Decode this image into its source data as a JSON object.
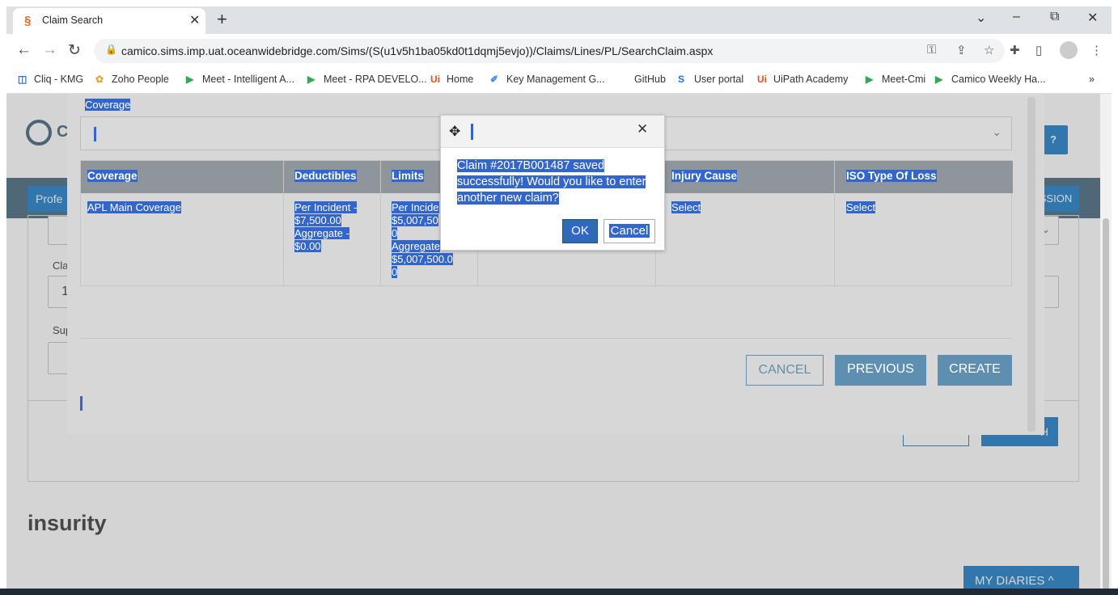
{
  "browser": {
    "tab_title": "Claim Search",
    "url": "camico.sims.imp.uat.oceanwidebridge.com/Sims/(S(u1v5h1ba05kd0t1dqmj5evjo))/Claims/Lines/PL/SearchClaim.aspx",
    "new_tab": "+",
    "close_tab": "✕",
    "minimize": "–",
    "restore": "⧉",
    "close_window": "✕",
    "chevron": "⌄"
  },
  "bookmarks": [
    {
      "label": "Cliq - KMG",
      "icon": "cliq-icon",
      "glyph": "◫",
      "color": "#1a73e8"
    },
    {
      "label": "Zoho People",
      "icon": "zoho-people-icon",
      "glyph": "✿",
      "color": "#e8a33b"
    },
    {
      "label": "Meet - Intelligent A...",
      "icon": "google-meet-icon",
      "glyph": "▶",
      "color": "#34a853"
    },
    {
      "label": "Meet - RPA DEVELO...",
      "icon": "google-meet-icon",
      "glyph": "▶",
      "color": "#34a853"
    },
    {
      "label": "Home",
      "icon": "uipath-icon",
      "glyph": "Ui",
      "color": "#fa4616"
    },
    {
      "label": "Key Management G...",
      "icon": "key-management-icon",
      "glyph": "✐",
      "color": "#4285f4"
    },
    {
      "label": "GitHub",
      "icon": "github-icon",
      "glyph": "",
      "color": "#333"
    },
    {
      "label": "User portal",
      "icon": "user-portal-icon",
      "glyph": "S",
      "color": "#1a73e8"
    },
    {
      "label": "UiPath Academy",
      "icon": "uipath-icon",
      "glyph": "Ui",
      "color": "#fa4616"
    },
    {
      "label": "Meet-Cmi",
      "icon": "google-meet-icon",
      "glyph": "▶",
      "color": "#34a853"
    },
    {
      "label": "Camico Weekly Ha...",
      "icon": "google-meet-icon",
      "glyph": "▶",
      "color": "#34a853"
    }
  ],
  "bookmarks_more": "»",
  "page": {
    "logo_text": "C",
    "help": "?",
    "nav_tab": "Profe",
    "nav_button": "SSION",
    "label_claim": "Cla",
    "label_sup": "Sup",
    "field_claim_value": "1",
    "search_button": "H",
    "brand": "insurity",
    "diaries": "MY DIARIES ^"
  },
  "coverage_modal": {
    "coverage_label": "Coverage",
    "columns": [
      "Coverage",
      "Deductibles",
      "Limits",
      "",
      "Injury Cause",
      "ISO Type Of Loss"
    ],
    "row": {
      "coverage": "APL Main Coverage",
      "deductibles": [
        "Per Incident -",
        "$7,500.00",
        "Aggregate -",
        "$0.00"
      ],
      "limits": [
        "Per Incide",
        "$5,007,50",
        "0",
        "Aggregate",
        "$5,007,500.0",
        "0"
      ],
      "injury_cause": "Select",
      "iso_type": "Select"
    },
    "buttons": {
      "cancel": "CANCEL",
      "previous": "PREVIOUS",
      "create": "CREATE"
    }
  },
  "confirm_dialog": {
    "message_lines": [
      "Claim #2017B001487 saved",
      "successfully! Would you like to enter",
      "another new claim?"
    ],
    "ok": "OK",
    "cancel": "Cancel",
    "close": "✕"
  }
}
